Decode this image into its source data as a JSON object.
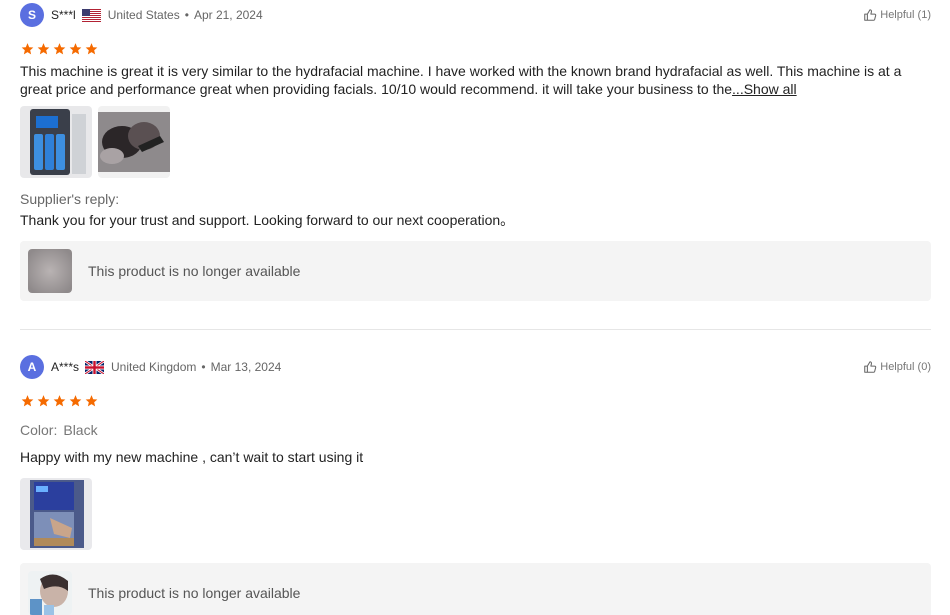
{
  "reviews": [
    {
      "avatar_letter": "S",
      "author": "S***l",
      "flag": "us-flag-icon",
      "country": "United States",
      "date": "Apr 21, 2024",
      "helpful": "Helpful (1)",
      "rating": 5,
      "text": "This machine is great it is very similar to the hydrafacial machine. I have worked with the known brand hydrafacial as well. This machine is at a great price and performance great when providing facials. 10/10 would recommend. it will take your business to the",
      "show_all": "...Show all",
      "supplier_reply_label": "Supplier's reply:",
      "supplier_reply": "Thank you for your trust and support. Looking forward to our next cooperation。",
      "unavailable": "This product is no longer available"
    },
    {
      "avatar_letter": "A",
      "author": "A***s",
      "flag": "uk-flag-icon",
      "country": "United Kingdom",
      "date": "Mar 13, 2024",
      "helpful": "Helpful (0)",
      "rating": 5,
      "color_label": "Color:",
      "color_value": "Black",
      "text": "Happy with my new machine , can’t wait to start using it",
      "unavailable": "This product is no longer available"
    }
  ],
  "separator": "•",
  "colors": {
    "star": "#f56a00",
    "avatar": "#5a6fe0"
  }
}
